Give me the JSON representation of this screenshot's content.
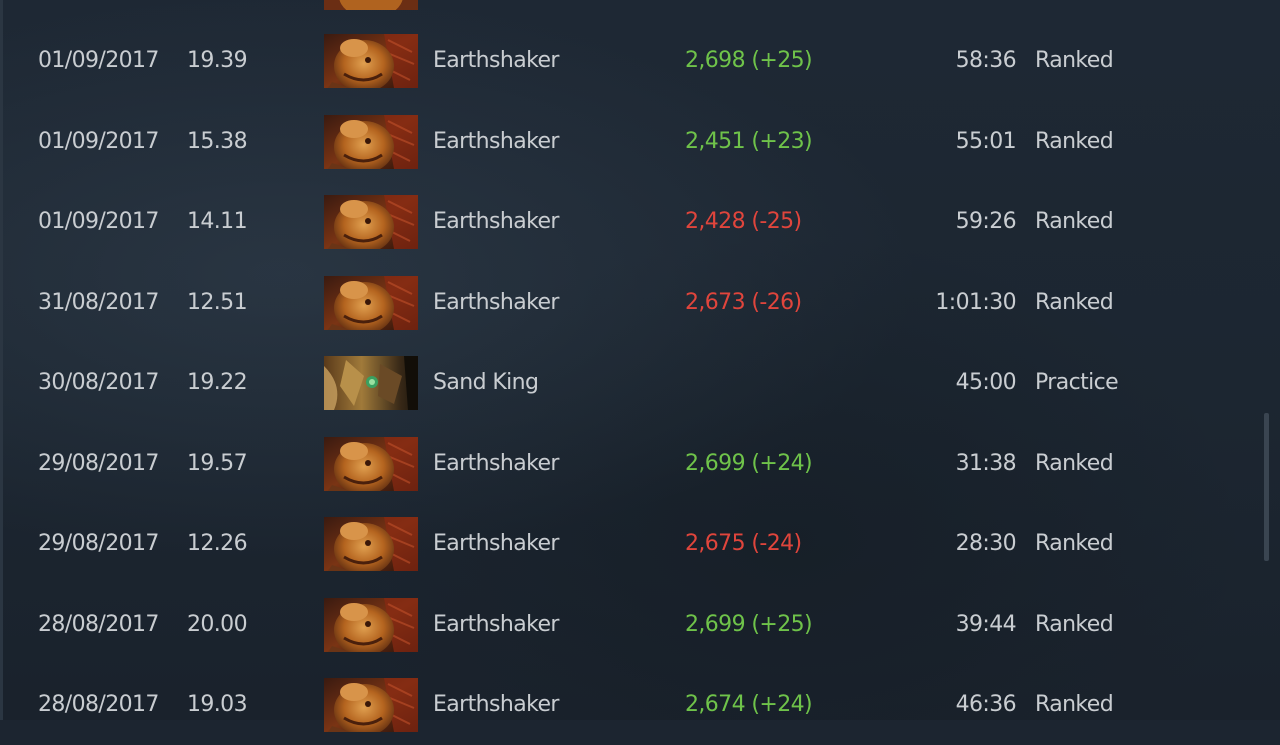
{
  "matches": [
    {
      "date": "01/09/2017",
      "time": "19.39",
      "hero": "Earthshaker",
      "hero_icon": "earthshaker-portrait",
      "mmr": "2,698 (+25)",
      "result": "win",
      "duration": "58:36",
      "type": "Ranked"
    },
    {
      "date": "01/09/2017",
      "time": "15.38",
      "hero": "Earthshaker",
      "hero_icon": "earthshaker-portrait",
      "mmr": "2,451 (+23)",
      "result": "win",
      "duration": "55:01",
      "type": "Ranked"
    },
    {
      "date": "01/09/2017",
      "time": "14.11",
      "hero": "Earthshaker",
      "hero_icon": "earthshaker-portrait",
      "mmr": "2,428 (-25)",
      "result": "loss",
      "duration": "59:26",
      "type": "Ranked"
    },
    {
      "date": "31/08/2017",
      "time": "12.51",
      "hero": "Earthshaker",
      "hero_icon": "earthshaker-portrait",
      "mmr": "2,673 (-26)",
      "result": "loss",
      "duration": "1:01:30",
      "type": "Ranked"
    },
    {
      "date": "30/08/2017",
      "time": "19.22",
      "hero": "Sand King",
      "hero_icon": "sand-king-portrait",
      "mmr": "",
      "result": "none",
      "duration": "45:00",
      "type": "Practice"
    },
    {
      "date": "29/08/2017",
      "time": "19.57",
      "hero": "Earthshaker",
      "hero_icon": "earthshaker-portrait",
      "mmr": "2,699 (+24)",
      "result": "win",
      "duration": "31:38",
      "type": "Ranked"
    },
    {
      "date": "29/08/2017",
      "time": "12.26",
      "hero": "Earthshaker",
      "hero_icon": "earthshaker-portrait",
      "mmr": "2,675 (-24)",
      "result": "loss",
      "duration": "28:30",
      "type": "Ranked"
    },
    {
      "date": "28/08/2017",
      "time": "20.00",
      "hero": "Earthshaker",
      "hero_icon": "earthshaker-portrait",
      "mmr": "2,699 (+25)",
      "result": "win",
      "duration": "39:44",
      "type": "Ranked"
    },
    {
      "date": "28/08/2017",
      "time": "19.03",
      "hero": "Earthshaker",
      "hero_icon": "earthshaker-portrait",
      "mmr": "2,674 (+24)",
      "result": "win",
      "duration": "46:36",
      "type": "Ranked"
    }
  ],
  "colors": {
    "background": "#1c2530",
    "text": "#c9cdd1",
    "mmr_gain": "#6fc34a",
    "mmr_loss": "#e0453c",
    "scrollbar_thumb": "#3a4551"
  }
}
